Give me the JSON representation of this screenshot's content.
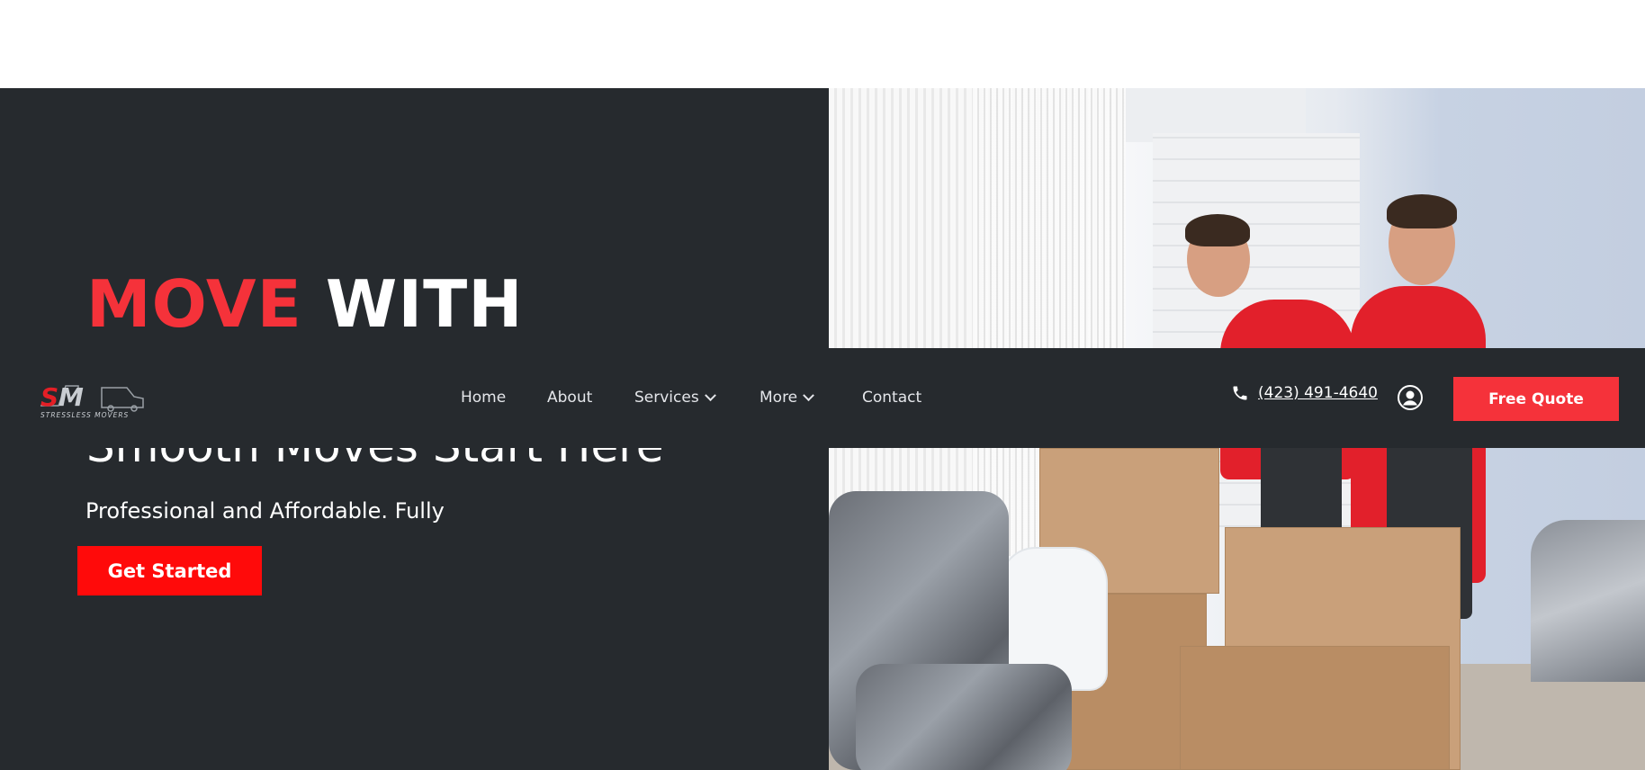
{
  "hero": {
    "headline_red": "MOVE",
    "headline_white": "WITH",
    "subheadline": "Smooth Moves Start Here",
    "lead": "Professional and Affordable. Fully",
    "cta_label": "Get Started",
    "image_alt": "Two movers packing cardboard boxes and wrapped furniture"
  },
  "navbar": {
    "logo": {
      "letters": "SM",
      "tagline": "STRESSLESS MOVERS"
    },
    "items": [
      {
        "label": "Home",
        "has_dropdown": false
      },
      {
        "label": "About",
        "has_dropdown": false
      },
      {
        "label": "Services",
        "has_dropdown": true
      },
      {
        "label": "More",
        "has_dropdown": true
      },
      {
        "label": "Contact",
        "has_dropdown": false
      }
    ],
    "phone": "(423) 491-4640",
    "quote_label": "Free Quote",
    "icons": {
      "phone": "phone-icon",
      "account": "user-account-icon",
      "dropdown": "chevron-down-icon"
    }
  },
  "colors": {
    "dark_bg": "#262a2e",
    "brand_red": "#f5323a",
    "cta_red": "#ff0a0a",
    "text_light": "#e4e6ea"
  }
}
